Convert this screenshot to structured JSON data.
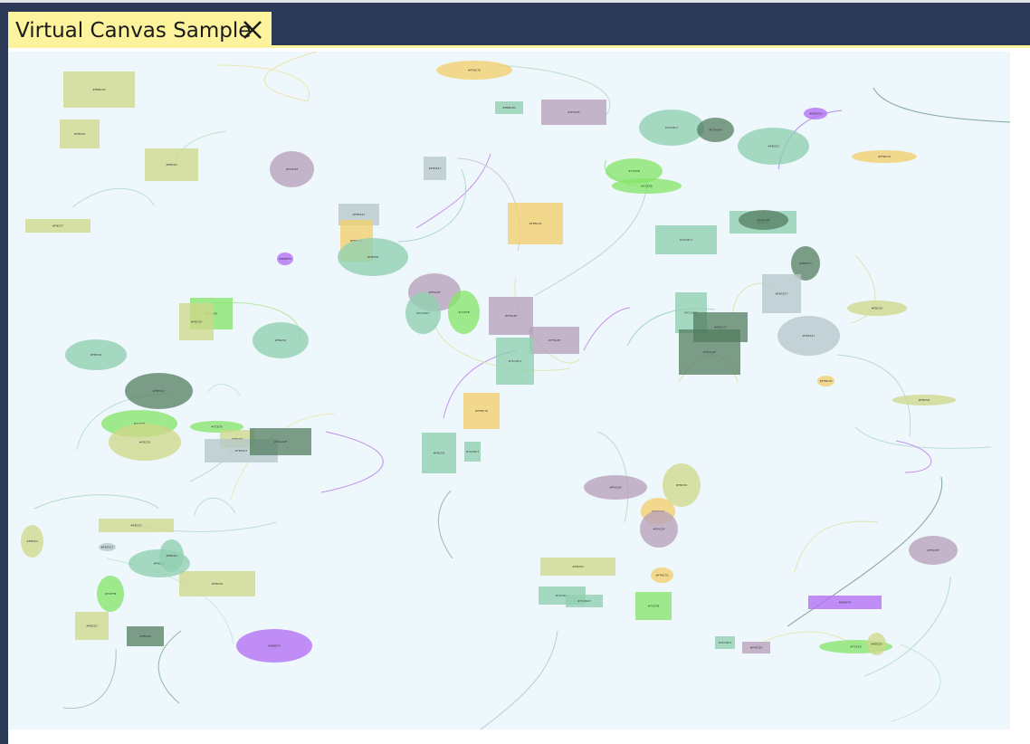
{
  "window": {
    "tab_title": "Virtual Canvas Sample",
    "close_icon": "close-icon"
  },
  "canvas": {
    "background": "#eef7fc",
    "palette": {
      "olive": "#cfd98a",
      "teal": "#8fcfb0",
      "mauve": "#b7a2bb",
      "gold": "#f2cf6b",
      "green": "#86e56a",
      "darkgreen": "#4f7a5c",
      "purple": "#b36ef2",
      "slate": "#b6c8cc"
    },
    "shapes": [
      {
        "kind": "rect",
        "label": "#FBBC5D",
        "color": "olive"
      },
      {
        "kind": "rect",
        "label": "#FBC5D",
        "color": "olive"
      },
      {
        "kind": "rect",
        "label": "#FBC5D",
        "color": "olive"
      },
      {
        "kind": "rect",
        "label": "#FBC57",
        "color": "olive"
      },
      {
        "kind": "ellipse",
        "label": "#FFBC76",
        "color": "gold"
      },
      {
        "kind": "rect",
        "label": "#FBBC5D",
        "color": "teal"
      },
      {
        "kind": "rect",
        "label": "#FF6C8F",
        "color": "mauve"
      },
      {
        "kind": "ellipse",
        "label": "#FF6C8F",
        "color": "mauve"
      },
      {
        "kind": "rect",
        "label": "#FB5517",
        "color": "slate"
      },
      {
        "kind": "rect",
        "label": "#FB5517",
        "color": "slate"
      },
      {
        "kind": "rect",
        "label": "#FBBC5D",
        "color": "gold"
      },
      {
        "kind": "rect",
        "label": "#FFBC76",
        "color": "gold"
      },
      {
        "kind": "ellipse",
        "label": "#FBC5D",
        "color": "teal"
      },
      {
        "kind": "ellipse",
        "label": "#BE6FF0",
        "color": "purple"
      },
      {
        "kind": "ellipse",
        "label": "#7CC6C7",
        "color": "teal"
      },
      {
        "kind": "ellipse",
        "label": "#7DAA9F",
        "color": "darkgreen"
      },
      {
        "kind": "ellipse",
        "label": "#FBC5D",
        "color": "teal"
      },
      {
        "kind": "ellipse",
        "label": "#BE6FF0",
        "color": "purple"
      },
      {
        "kind": "ellipse",
        "label": "#FFBC76",
        "color": "gold"
      },
      {
        "kind": "ellipse",
        "label": "#7CE7B",
        "color": "green"
      },
      {
        "kind": "ellipse",
        "label": "#7CE7B",
        "color": "green"
      },
      {
        "kind": "rect",
        "label": "#7CC6C7",
        "color": "teal"
      },
      {
        "kind": "rect",
        "label": "#FBC5D",
        "color": "teal"
      },
      {
        "kind": "ellipse",
        "label": "#7DAA9F",
        "color": "darkgreen"
      },
      {
        "kind": "ellipse",
        "label": "#FB5E7C",
        "color": "darkgreen"
      },
      {
        "kind": "rect",
        "label": "#FB5517",
        "color": "slate"
      },
      {
        "kind": "ellipse",
        "label": "#FBC5D",
        "color": "olive"
      },
      {
        "kind": "rect",
        "label": "#7CE7B",
        "color": "green"
      },
      {
        "kind": "rect",
        "label": "#FBC5D",
        "color": "olive"
      },
      {
        "kind": "ellipse",
        "label": "#FBC5D",
        "color": "teal"
      },
      {
        "kind": "ellipse",
        "label": "#FF6C8F",
        "color": "mauve"
      },
      {
        "kind": "ellipse",
        "label": "#7CC6C7",
        "color": "teal"
      },
      {
        "kind": "ellipse",
        "label": "#7CE7B",
        "color": "green"
      },
      {
        "kind": "rect",
        "label": "#FF6C8F",
        "color": "mauve"
      },
      {
        "kind": "rect",
        "label": "#FF6C8F",
        "color": "mauve"
      },
      {
        "kind": "rect",
        "label": "#7CC6C7",
        "color": "teal"
      },
      {
        "kind": "rect",
        "label": "#7CC6C7",
        "color": "teal"
      },
      {
        "kind": "rect",
        "label": "#FB5517",
        "color": "darkgreen"
      },
      {
        "kind": "rect",
        "label": "#7DAA9F",
        "color": "darkgreen"
      },
      {
        "kind": "ellipse",
        "label": "#FB5517",
        "color": "slate"
      },
      {
        "kind": "ellipse",
        "label": "#FBC5D",
        "color": "teal"
      },
      {
        "kind": "ellipse",
        "label": "#FB5517",
        "color": "darkgreen"
      },
      {
        "kind": "ellipse",
        "label": "#FBC5D",
        "color": "olive"
      },
      {
        "kind": "ellipse",
        "label": "#7CE7B",
        "color": "green"
      },
      {
        "kind": "ellipse",
        "label": "#FBC5D",
        "color": "olive"
      },
      {
        "kind": "ellipse",
        "label": "#7CE7B",
        "color": "green"
      },
      {
        "kind": "rect",
        "label": "#FBC5D",
        "color": "olive"
      },
      {
        "kind": "rect",
        "label": "#FB5517",
        "color": "slate"
      },
      {
        "kind": "rect",
        "label": "#7DAA9F",
        "color": "darkgreen"
      },
      {
        "kind": "ellipse",
        "label": "#FFBC76",
        "color": "gold"
      },
      {
        "kind": "rect",
        "label": "#FBC5D",
        "color": "teal"
      },
      {
        "kind": "rect",
        "label": "#7CC6C7",
        "color": "teal"
      },
      {
        "kind": "rect",
        "label": "#FFBC76",
        "color": "gold"
      },
      {
        "kind": "ellipse",
        "label": "#FF6C8F",
        "color": "mauve"
      },
      {
        "kind": "ellipse",
        "label": "#FBC5D",
        "color": "olive"
      },
      {
        "kind": "ellipse",
        "label": "#FFBC76",
        "color": "gold"
      },
      {
        "kind": "rect",
        "label": "#FBC5D",
        "color": "olive"
      },
      {
        "kind": "ellipse",
        "label": "#FBC5D",
        "color": "olive"
      },
      {
        "kind": "ellipse",
        "label": "#FF6C8F",
        "color": "mauve"
      },
      {
        "kind": "rect",
        "label": "#FBC5D",
        "color": "olive"
      },
      {
        "kind": "ellipse",
        "label": "#FB5517",
        "color": "slate"
      },
      {
        "kind": "ellipse",
        "label": "#FBC5D",
        "color": "teal"
      },
      {
        "kind": "ellipse",
        "label": "#FBC5D",
        "color": "teal"
      },
      {
        "kind": "ellipse",
        "label": "#7CE7B",
        "color": "green"
      },
      {
        "kind": "rect",
        "label": "#FBC5D",
        "color": "olive"
      },
      {
        "kind": "rect",
        "label": "#FBC5D",
        "color": "darkgreen"
      },
      {
        "kind": "rect",
        "label": "#FBC5D",
        "color": "olive"
      },
      {
        "kind": "ellipse",
        "label": "#BE6FF0",
        "color": "purple"
      },
      {
        "kind": "rect",
        "label": "#7CC6C7",
        "color": "teal"
      },
      {
        "kind": "rect",
        "label": "#7CC6C7",
        "color": "teal"
      },
      {
        "kind": "ellipse",
        "label": "#FFBC76",
        "color": "gold"
      },
      {
        "kind": "rect",
        "label": "#7CE7B",
        "color": "green"
      },
      {
        "kind": "rect",
        "label": "#BE6FF0",
        "color": "purple"
      },
      {
        "kind": "ellipse",
        "label": "#FF6C8F",
        "color": "mauve"
      },
      {
        "kind": "rect",
        "label": "#FF6C8F",
        "color": "mauve"
      },
      {
        "kind": "ellipse",
        "label": "#7CE7B",
        "color": "green"
      },
      {
        "kind": "ellipse",
        "label": "#FBC5D",
        "color": "olive"
      },
      {
        "kind": "rect",
        "label": "#7CC6C7",
        "color": "teal"
      },
      {
        "kind": "rect",
        "label": "#7DAA9F",
        "color": "darkgreen"
      },
      {
        "kind": "rect",
        "label": "#FF6C8F",
        "color": "mauve"
      }
    ]
  }
}
